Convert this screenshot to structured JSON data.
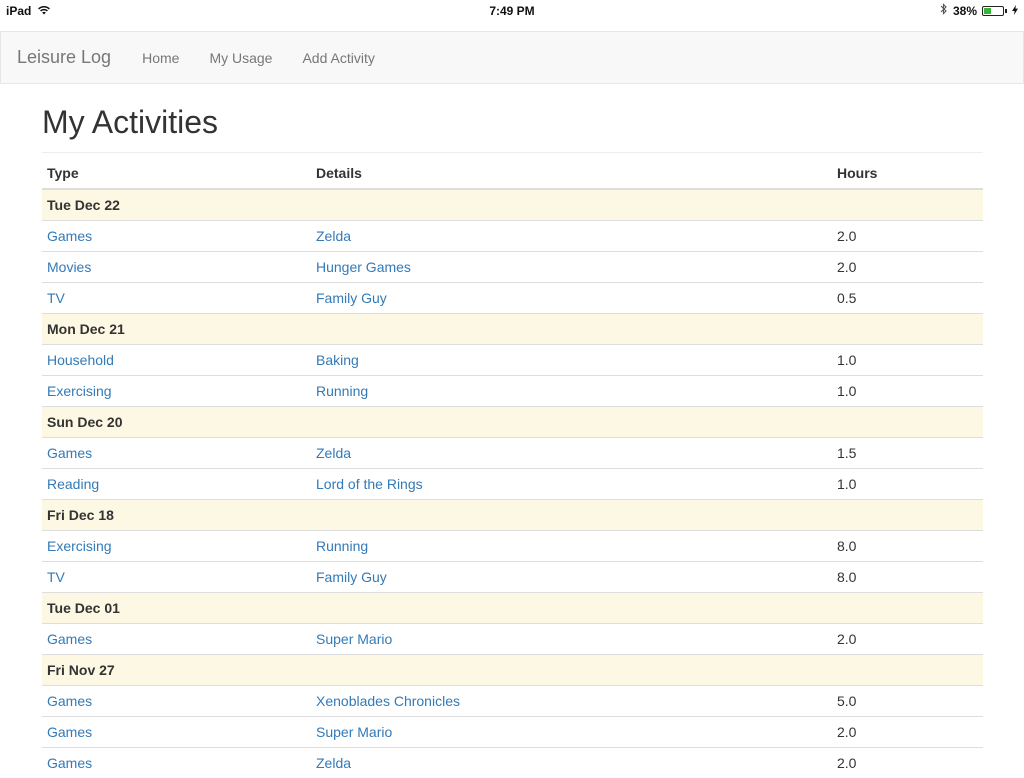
{
  "status_bar": {
    "device": "iPad",
    "wifi_icon": "wifi-icon",
    "time": "7:49 PM",
    "bluetooth_icon": "bluetooth-icon",
    "battery_percent": "38%",
    "battery_level": 0.38,
    "charging_icon": "charging-bolt-icon"
  },
  "navbar": {
    "brand": "Leisure Log",
    "links": [
      "Home",
      "My Usage",
      "Add Activity"
    ]
  },
  "page": {
    "title": "My Activities"
  },
  "table": {
    "headers": {
      "type": "Type",
      "details": "Details",
      "hours": "Hours"
    },
    "groups": [
      {
        "date": "Tue Dec 22",
        "rows": [
          {
            "type": "Games",
            "details": "Zelda",
            "hours": "2.0"
          },
          {
            "type": "Movies",
            "details": "Hunger Games",
            "hours": "2.0"
          },
          {
            "type": "TV",
            "details": "Family Guy",
            "hours": "0.5"
          }
        ]
      },
      {
        "date": "Mon Dec 21",
        "rows": [
          {
            "type": "Household",
            "details": "Baking",
            "hours": "1.0"
          },
          {
            "type": "Exercising",
            "details": "Running",
            "hours": "1.0"
          }
        ]
      },
      {
        "date": "Sun Dec 20",
        "rows": [
          {
            "type": "Games",
            "details": "Zelda",
            "hours": "1.5"
          },
          {
            "type": "Reading",
            "details": "Lord of the Rings",
            "hours": "1.0"
          }
        ]
      },
      {
        "date": "Fri Dec 18",
        "rows": [
          {
            "type": "Exercising",
            "details": "Running",
            "hours": "8.0"
          },
          {
            "type": "TV",
            "details": "Family Guy",
            "hours": "8.0"
          }
        ]
      },
      {
        "date": "Tue Dec 01",
        "rows": [
          {
            "type": "Games",
            "details": "Super Mario",
            "hours": "2.0"
          }
        ]
      },
      {
        "date": "Fri Nov 27",
        "rows": [
          {
            "type": "Games",
            "details": "Xenoblades Chronicles",
            "hours": "5.0"
          },
          {
            "type": "Games",
            "details": "Super Mario",
            "hours": "2.0"
          },
          {
            "type": "Games",
            "details": "Zelda",
            "hours": "2.0"
          }
        ]
      }
    ]
  },
  "colors": {
    "link": "#337ab7",
    "date_row_bg": "#fcf8e3",
    "navbar_bg": "#f8f8f8"
  }
}
